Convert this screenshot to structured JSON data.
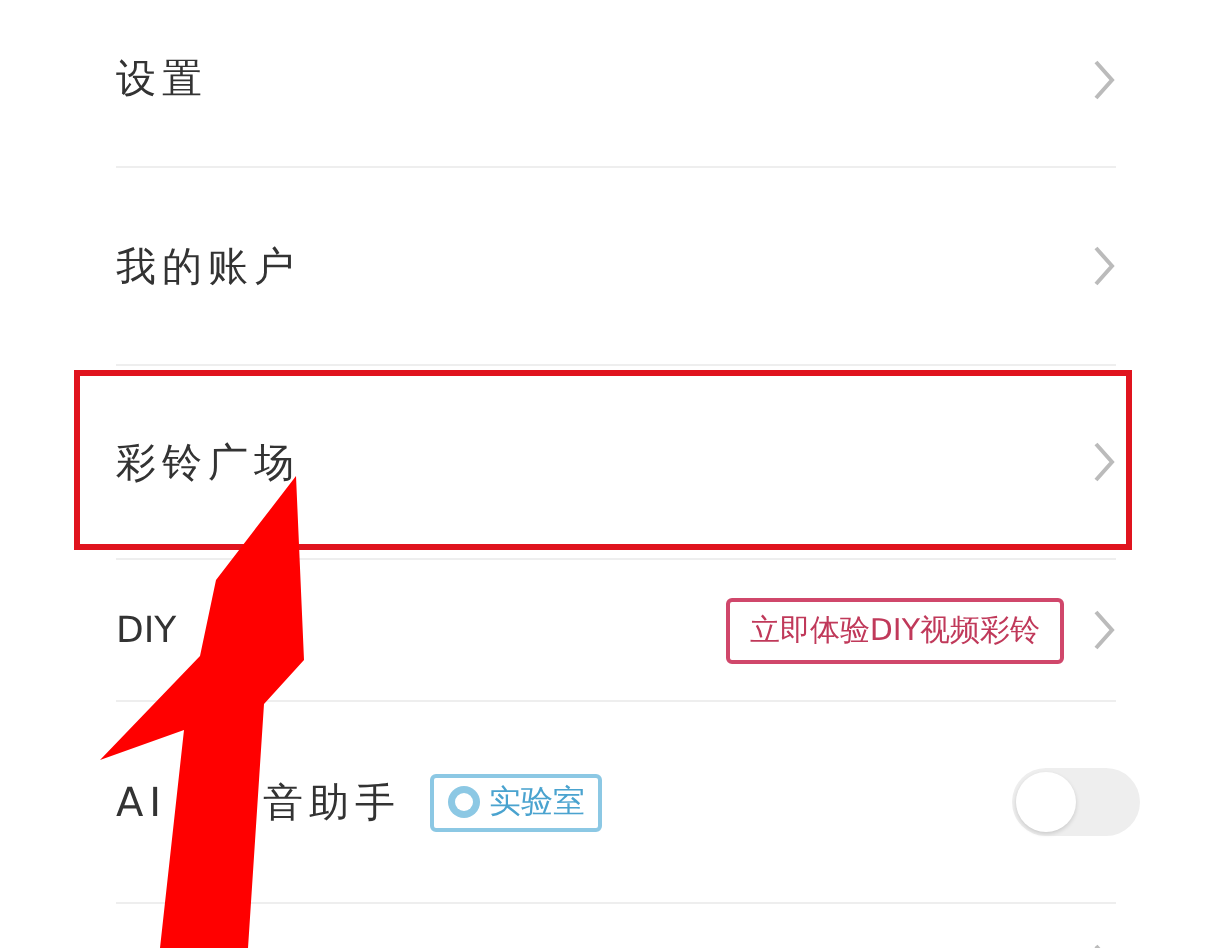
{
  "menu_items": [
    {
      "kind": "link",
      "label": "设置",
      "highlighted": false
    },
    {
      "kind": "link",
      "label": "我的账户",
      "highlighted": false
    },
    {
      "kind": "link",
      "label": "彩铃广场",
      "highlighted": true
    },
    {
      "kind": "promo",
      "label": "DIY",
      "badge": "立即体验DIY视频彩铃",
      "highlighted": false
    },
    {
      "kind": "toggle",
      "label": "AI",
      "label_rest": "音助手",
      "tag": "实验室",
      "on": false,
      "highlighted": false
    },
    {
      "kind": "partial",
      "highlighted": false
    }
  ]
}
